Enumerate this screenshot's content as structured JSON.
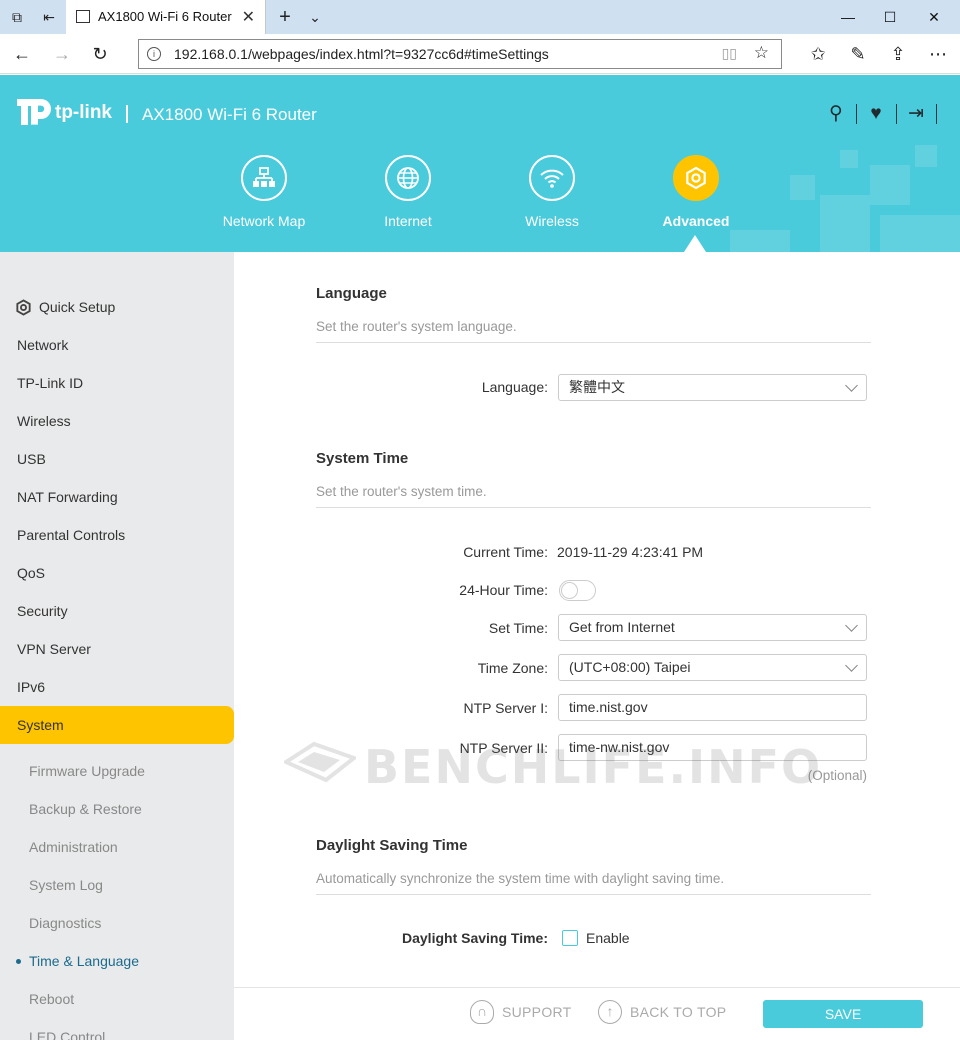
{
  "browser": {
    "tab_title": "AX1800 Wi-Fi 6 Router",
    "url": "192.168.0.1/webpages/index.html?t=9327cc6d#timeSettings"
  },
  "header": {
    "logo_text": "tp-link",
    "model": "AX1800 Wi-Fi 6 Router",
    "nav": [
      {
        "label": "Network Map",
        "icon": "network-map-icon"
      },
      {
        "label": "Internet",
        "icon": "globe-icon"
      },
      {
        "label": "Wireless",
        "icon": "wifi-icon"
      },
      {
        "label": "Advanced",
        "icon": "gear-icon",
        "active": true
      }
    ]
  },
  "sidebar": {
    "items": [
      {
        "label": "Quick Setup"
      },
      {
        "label": "Network"
      },
      {
        "label": "TP-Link ID"
      },
      {
        "label": "Wireless"
      },
      {
        "label": "USB"
      },
      {
        "label": "NAT Forwarding"
      },
      {
        "label": "Parental Controls"
      },
      {
        "label": "QoS"
      },
      {
        "label": "Security"
      },
      {
        "label": "VPN Server"
      },
      {
        "label": "IPv6"
      },
      {
        "label": "System",
        "active": true
      }
    ],
    "subitems": [
      {
        "label": "Firmware Upgrade"
      },
      {
        "label": "Backup & Restore"
      },
      {
        "label": "Administration"
      },
      {
        "label": "System Log"
      },
      {
        "label": "Diagnostics"
      },
      {
        "label": "Time & Language",
        "current": true
      },
      {
        "label": "Reboot"
      },
      {
        "label": "LED Control"
      }
    ]
  },
  "language": {
    "title": "Language",
    "desc": "Set the router's system language.",
    "label": "Language:",
    "value": "繁體中文"
  },
  "system_time": {
    "title": "System Time",
    "desc": "Set the router's system time.",
    "current_time_label": "Current Time:",
    "current_time": "2019-11-29 4:23:41 PM",
    "hour24_label": "24-Hour Time:",
    "hour24_on": false,
    "set_time_label": "Set Time:",
    "set_time": "Get from Internet",
    "timezone_label": "Time Zone:",
    "timezone": "(UTC+08:00) Taipei",
    "ntp1_label": "NTP Server I:",
    "ntp1": "time.nist.gov",
    "ntp2_label": "NTP Server II:",
    "ntp2": "time-nw.nist.gov",
    "optional": "(Optional)"
  },
  "dst": {
    "title": "Daylight Saving Time",
    "desc": "Automatically synchronize the system time with daylight saving time.",
    "label": "Daylight Saving Time:",
    "enable_label": "Enable",
    "enabled": false
  },
  "watermark": "BENCHLIFE.INFO",
  "footer": {
    "support": "SUPPORT",
    "back_to_top": "BACK TO TOP",
    "save": "SAVE"
  },
  "colors": {
    "accent": "#4acbdc",
    "active": "#ffc400"
  }
}
